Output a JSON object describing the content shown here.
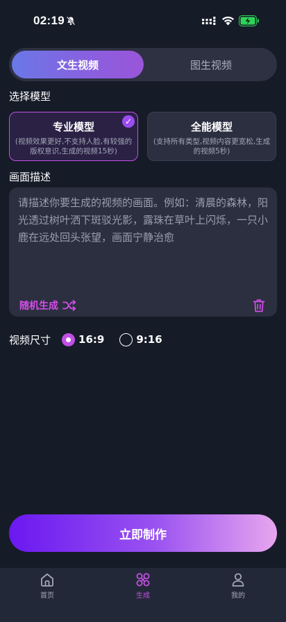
{
  "status_bar": {
    "time": "02:19"
  },
  "tabs": [
    {
      "label": "文生视频",
      "active": true
    },
    {
      "label": "图生视频",
      "active": false
    }
  ],
  "model_section": {
    "title": "选择模型",
    "cards": [
      {
        "title": "专业模型",
        "desc": "(视频效果更好,不支持人脸,有较强的版权意识,生成的视频15秒)",
        "selected": true
      },
      {
        "title": "全能模型",
        "desc": "(支持所有类型,视频内容更宽松,生成的视频5秒)",
        "selected": false
      }
    ]
  },
  "description_section": {
    "title": "画面描述",
    "placeholder": "请描述你要生成的视频的画面。例如：清晨的森林，阳光透过树叶洒下斑驳光影，露珠在草叶上闪烁，一只小鹿在远处回头张望，画面宁静治愈",
    "random_label": "随机生成"
  },
  "video_size": {
    "label": "视频尺寸",
    "options": [
      {
        "label": "16:9",
        "selected": true
      },
      {
        "label": "9:16",
        "selected": false
      }
    ]
  },
  "cta": {
    "label": "立即制作"
  },
  "bottom_nav": [
    {
      "label": "首页",
      "icon": "home-icon",
      "active": false
    },
    {
      "label": "生成",
      "icon": "create-icon",
      "active": true
    },
    {
      "label": "我的",
      "icon": "profile-icon",
      "active": false
    }
  ],
  "colors": {
    "background": "#161b28",
    "accent": "#c24fe4",
    "card": "#2b2f40"
  }
}
